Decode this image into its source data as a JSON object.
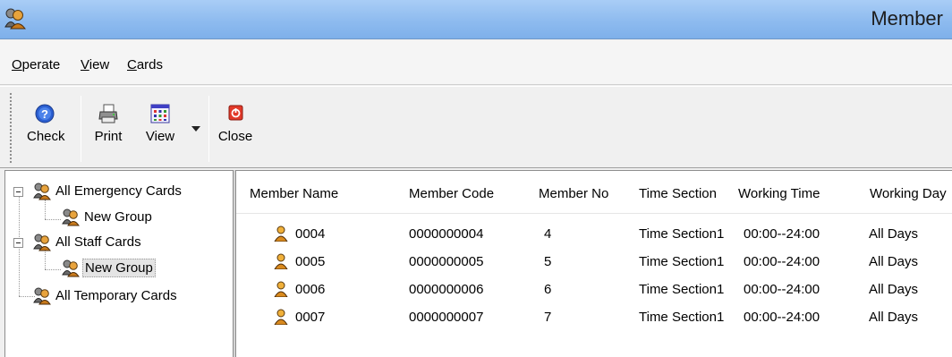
{
  "window": {
    "title": "Member"
  },
  "menu": [
    {
      "accel": "O",
      "rest": "perate"
    },
    {
      "accel": "V",
      "rest": "iew"
    },
    {
      "accel": "C",
      "rest": "ards"
    }
  ],
  "toolbar": {
    "check_label": "Check",
    "print_label": "Print",
    "view_label": "View",
    "close_label": "Close"
  },
  "tree": {
    "nodes": [
      {
        "label": "All Emergency Cards"
      },
      {
        "label": "New Group"
      },
      {
        "label": "All Staff Cards"
      },
      {
        "label": "New Group"
      },
      {
        "label": "All Temporary Cards"
      }
    ]
  },
  "list": {
    "columns": [
      "Member Name",
      "Member Code",
      "Member No",
      "Time Section",
      "Working Time",
      "Working Day"
    ],
    "rows": [
      [
        "0004",
        "0000000004",
        "4",
        "Time Section1",
        "00:00--24:00",
        "All Days"
      ],
      [
        "0005",
        "0000000005",
        "5",
        "Time Section1",
        "00:00--24:00",
        "All Days"
      ],
      [
        "0006",
        "0000000006",
        "6",
        "Time Section1",
        "00:00--24:00",
        "All Days"
      ],
      [
        "0007",
        "0000000007",
        "7",
        "Time Section1",
        "00:00--24:00",
        "All Days"
      ]
    ]
  }
}
